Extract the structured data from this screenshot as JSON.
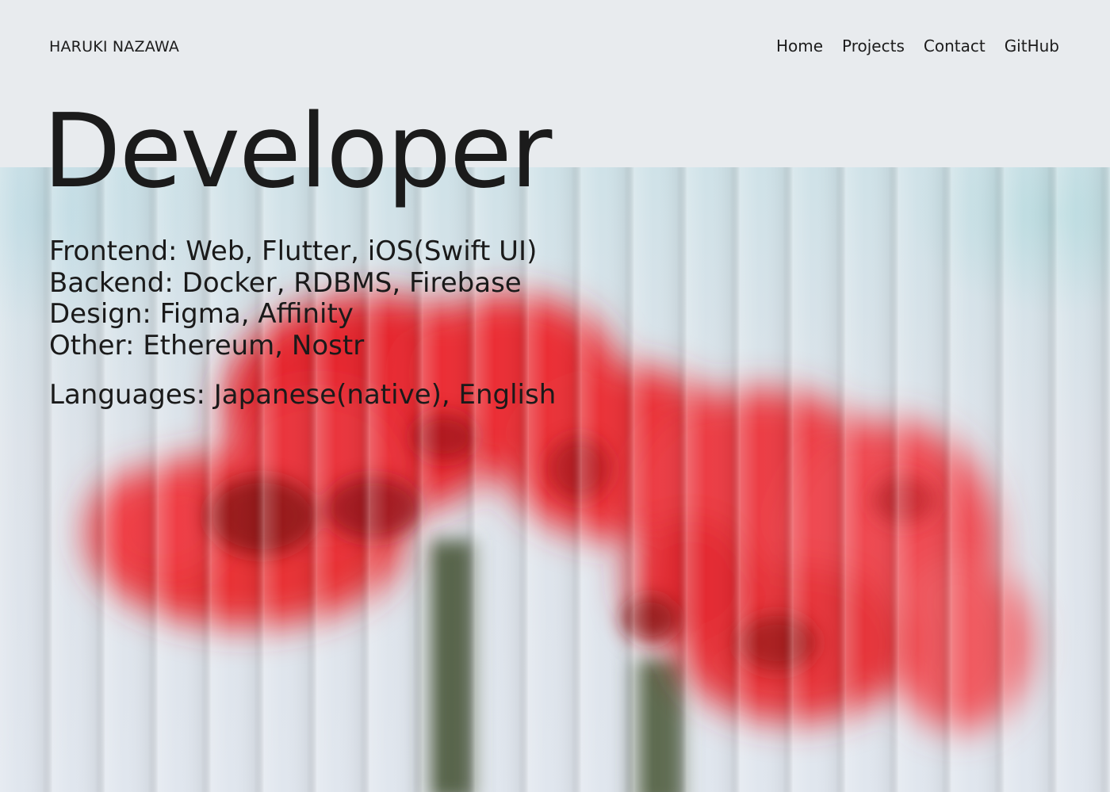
{
  "header": {
    "site_name": "HARUKI NAZAWA",
    "nav": [
      {
        "label": "Home"
      },
      {
        "label": "Projects"
      },
      {
        "label": "Contact"
      },
      {
        "label": "GitHub"
      }
    ]
  },
  "hero": {
    "title": "Developer",
    "skills": [
      {
        "text": "Frontend: Web, Flutter, iOS(Swift UI)"
      },
      {
        "text": "Backend: Docker, RDBMS, Firebase"
      },
      {
        "text": "Design: Figma, Affinity"
      },
      {
        "text": "Other: Ethereum, Nostr"
      }
    ],
    "languages": "Languages: Japanese(native), English"
  },
  "background": {
    "image": "blurred-red-flower-photo",
    "colors": {
      "page": "#e8ebee",
      "flower": "#e8262c",
      "stem": "#5b6a4f"
    }
  }
}
